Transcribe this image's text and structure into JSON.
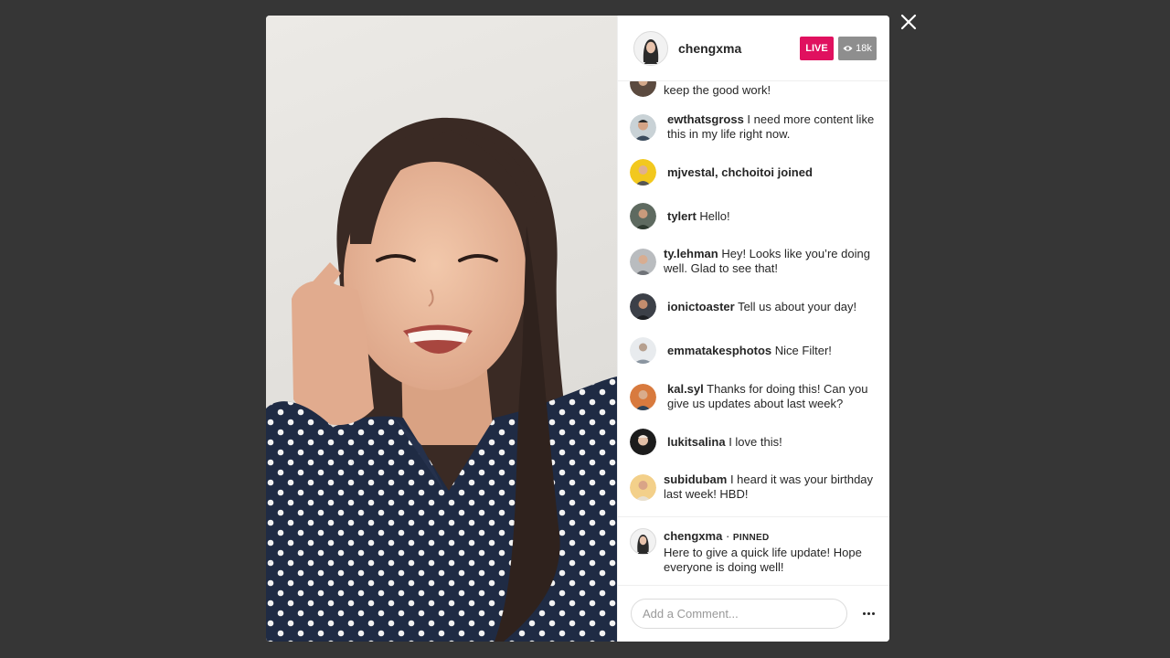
{
  "host": {
    "username": "chengxma",
    "live_label": "LIVE",
    "viewers": "18k"
  },
  "comments": [
    {
      "user": "",
      "text": "keep the good work!"
    },
    {
      "user": "ewthatsgross",
      "text": " I need more content like this in my life right now."
    },
    {
      "user": "mjvestal, chchoitoi joined",
      "text": ""
    },
    {
      "user": "tylert",
      "text": " Hello!"
    },
    {
      "user": "ty.lehman",
      "text": " Hey! Looks like you’re doing well. Glad to see that!"
    },
    {
      "user": "ionictoaster",
      "text": " Tell us about your day!"
    },
    {
      "user": "emmatakesphotos",
      "text": " Nice Filter!"
    },
    {
      "user": "kal.syl",
      "text": " Thanks for doing this! Can you give us updates about last week?"
    },
    {
      "user": "lukitsalina",
      "text": " I love this!"
    },
    {
      "user": "subidubam",
      "text": " I heard it was your birthday last week! HBD!"
    }
  ],
  "pinned": {
    "user": "chengxma",
    "separator": "·",
    "tag": "PINNED",
    "text": "Here to give a quick life update! Hope everyone is doing well!"
  },
  "composer": {
    "placeholder": "Add a Comment..."
  },
  "colors": {
    "live": "#e0115f",
    "viewer_badge": "#8e8e8e",
    "backdrop": "#363636"
  },
  "icons": [
    "close-icon",
    "eye-icon",
    "more-icon"
  ]
}
